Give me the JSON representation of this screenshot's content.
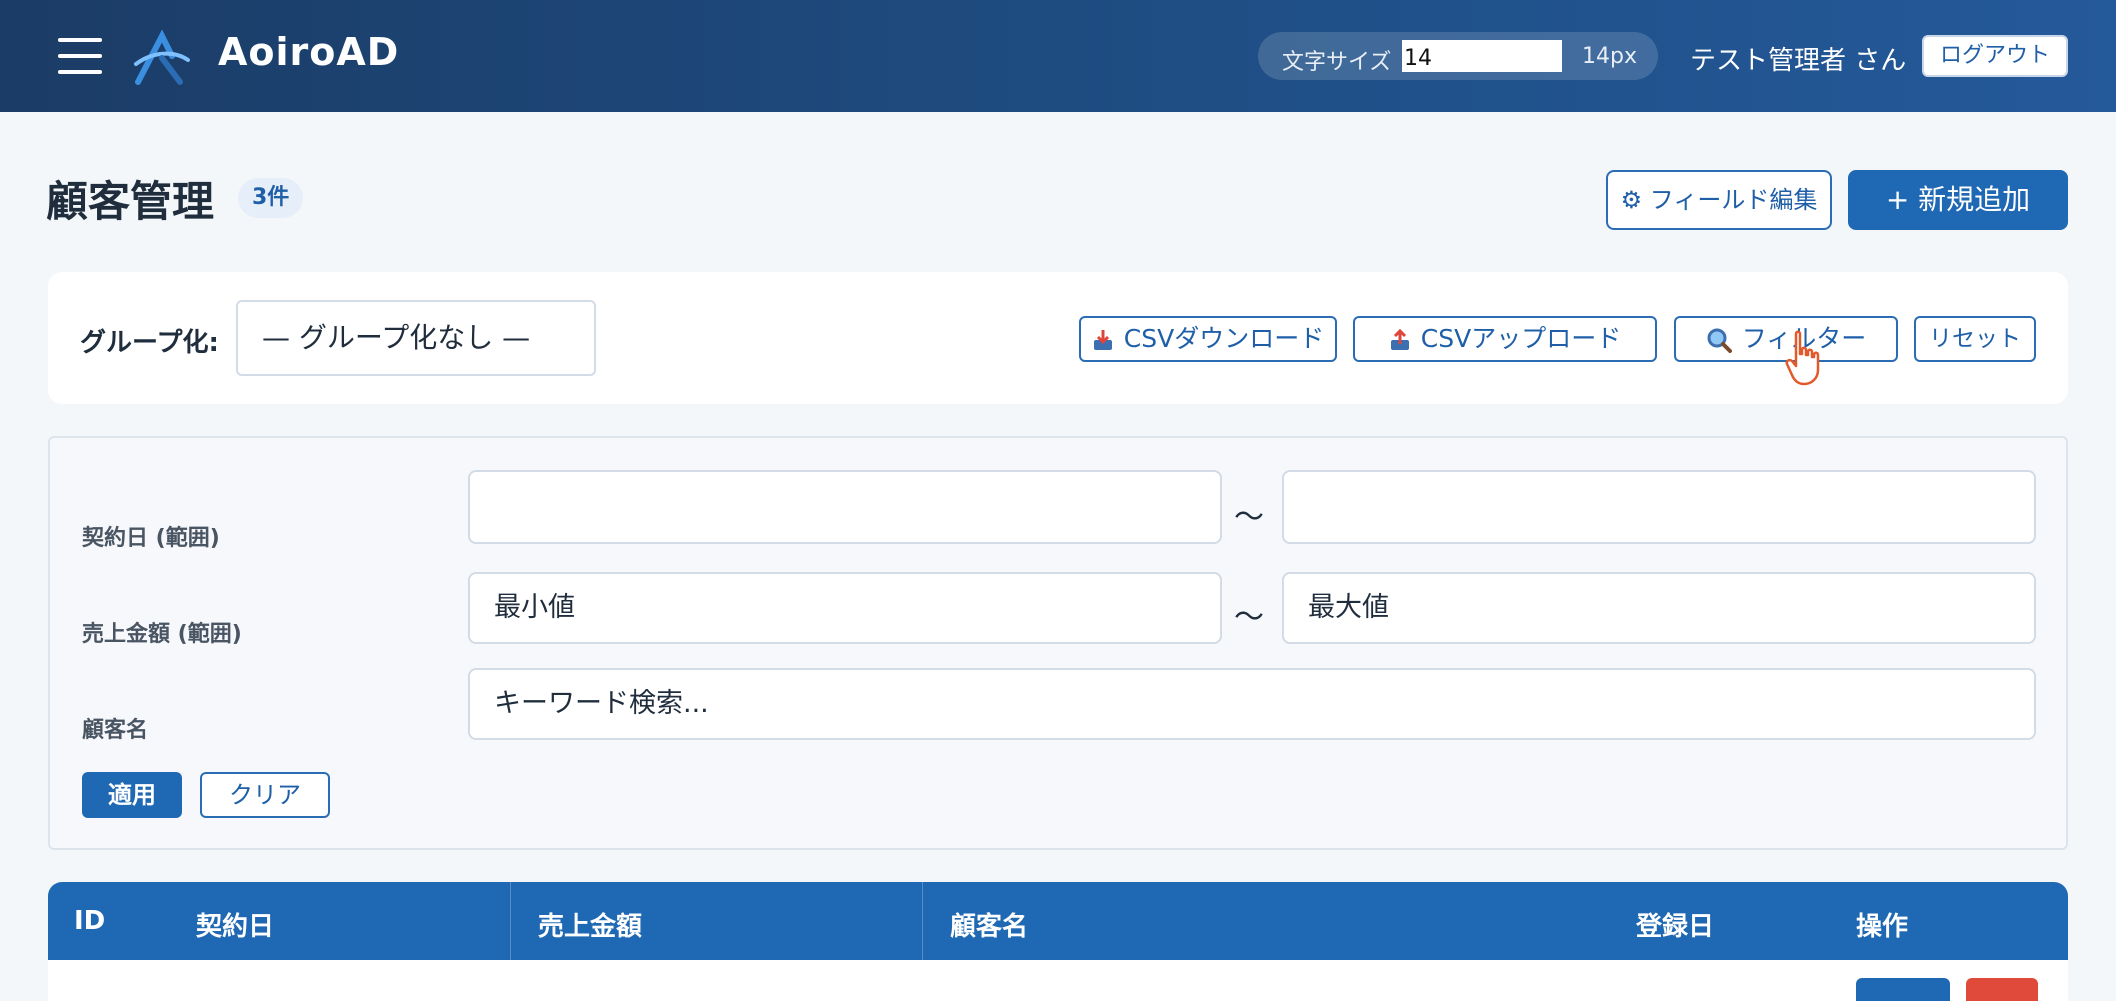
{
  "header": {
    "brand": "AoiroAD",
    "font_size_label": "文字サイズ",
    "font_size_value": "14",
    "font_size_unit": "14px",
    "user": "テスト管理者 さん",
    "logout_label": "ログアウト"
  },
  "page": {
    "title": "顧客管理",
    "count": "3件",
    "field_edit_label": "⚙ フィールド編集",
    "add_label": "+ 新規追加"
  },
  "toolbar": {
    "group_label": "グループ化:",
    "group_selected": "— グループ化なし —",
    "csv_download_label": "CSVダウンロード",
    "csv_upload_label": "CSVアップロード",
    "filter_label": "フィルター",
    "reset_label": "リセット"
  },
  "filters": {
    "contract_date_label": "契約日 (範囲)",
    "contract_date_from": "",
    "contract_date_to": "",
    "sales_label": "売上金額 (範囲)",
    "sales_min_placeholder": "最小値",
    "sales_max_placeholder": "最大値",
    "customer_label": "顧客名",
    "customer_placeholder": "キーワード検索...",
    "range_separator": "〜",
    "apply_label": "適用",
    "clear_label": "クリア"
  },
  "table": {
    "columns": [
      "ID",
      "契約日",
      "売上金額",
      "顧客名",
      "登録日",
      "操作"
    ]
  },
  "colors": {
    "primary": "#1f68b3",
    "header_bg": "#1b3c66",
    "danger": "#e04a3a"
  }
}
